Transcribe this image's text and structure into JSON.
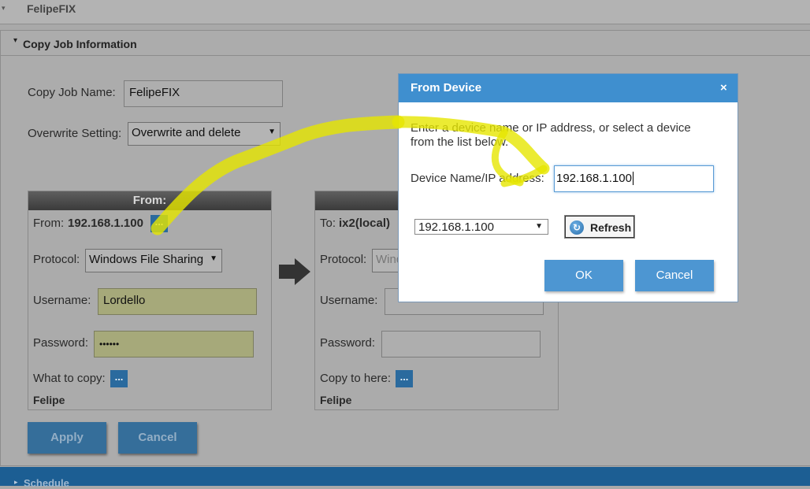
{
  "header": {
    "caret": "▾",
    "title": "FelipeFIX"
  },
  "section": {
    "caret": "▾",
    "title": "Copy Job Information"
  },
  "form": {
    "job_name_label": "Copy Job Name:",
    "job_name_value": "FelipeFIX",
    "overwrite_label": "Overwrite Setting:",
    "overwrite_value": "Overwrite and delete"
  },
  "from_panel": {
    "header": "From:",
    "from_label": "From:",
    "from_value": "192.168.1.100",
    "browse_dots": "...",
    "protocol_label": "Protocol:",
    "protocol_value": "Windows File Sharing",
    "username_label": "Username:",
    "username_value": "Lordello",
    "password_label": "Password:",
    "password_value": "••••••",
    "what_label": "What to copy:",
    "what_dots": "...",
    "folder": "Felipe"
  },
  "to_panel": {
    "to_label": "To:",
    "to_value": "ix2(local)",
    "protocol_label": "Protocol:",
    "protocol_value": "Wind",
    "username_label": "Username:",
    "password_label": "Password:",
    "copy_here_label": "Copy to here:",
    "copy_here_dots": "...",
    "folder": "Felipe"
  },
  "buttons": {
    "apply": "Apply",
    "cancel": "Cancel"
  },
  "schedule": {
    "caret": "▸",
    "title": "Schedule"
  },
  "dialog": {
    "title": "From Device",
    "close": "×",
    "instructions_line1": "Enter a device name or IP address, or select a device",
    "instructions_line2": "from the list below.",
    "device_label": "Device Name/IP address:",
    "device_value": "192.168.1.100",
    "device_select_value": "192.168.1.100",
    "refresh_label": "Refresh",
    "ok": "OK",
    "cancel": "Cancel"
  },
  "colors": {
    "dialog_header": "#3f8fcf",
    "highlight": "#e6e600",
    "primary_button": "#356e9a"
  }
}
